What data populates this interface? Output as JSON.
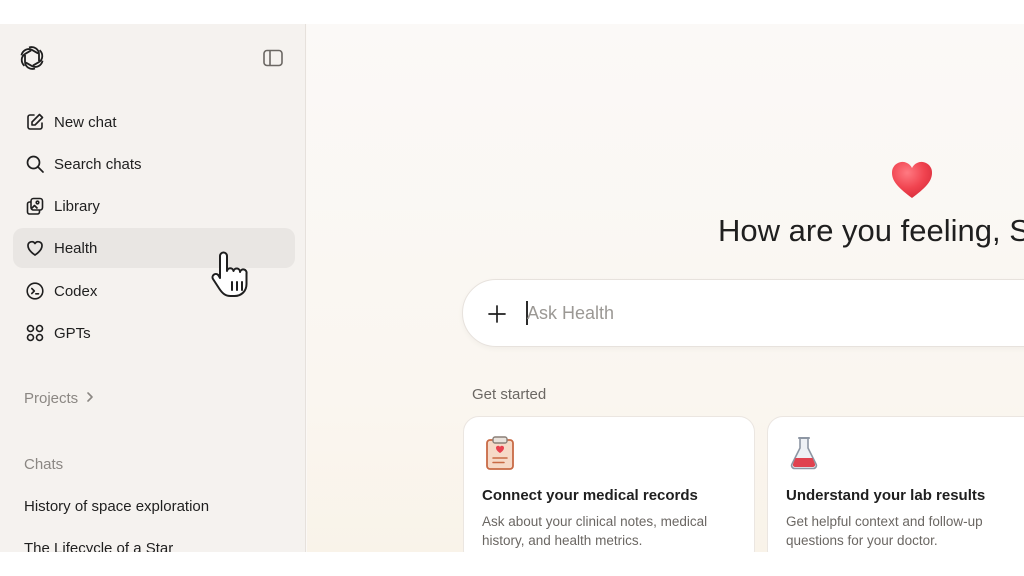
{
  "sidebar": {
    "nav": [
      {
        "label": "New chat",
        "icon": "pencil-square-icon"
      },
      {
        "label": "Search chats",
        "icon": "search-icon"
      },
      {
        "label": "Library",
        "icon": "library-icon"
      },
      {
        "label": "Health",
        "icon": "heart-outline-icon"
      },
      {
        "label": "Codex",
        "icon": "codex-icon"
      },
      {
        "label": "GPTs",
        "icon": "grid-circles-icon"
      }
    ],
    "projects_label": "Projects",
    "chats_label": "Chats",
    "chats": [
      "History of space exploration",
      "The Lifecycle of a Star"
    ]
  },
  "main": {
    "greeting": "How are you feeling, S",
    "composer": {
      "placeholder": "Ask Health"
    },
    "get_started_label": "Get started",
    "cards": [
      {
        "title": "Connect your medical records",
        "description": "Ask about your clinical notes, medical history, and health metrics.",
        "icon": "clipboard-icon"
      },
      {
        "title": "Understand your lab results",
        "description": "Get helpful context and follow-up questions for your doctor.",
        "icon": "flask-icon"
      }
    ]
  },
  "colors": {
    "heart": "#f0434f",
    "sidebar_bg": "#f5f2ef",
    "active_item_bg": "#e9e6e3"
  }
}
